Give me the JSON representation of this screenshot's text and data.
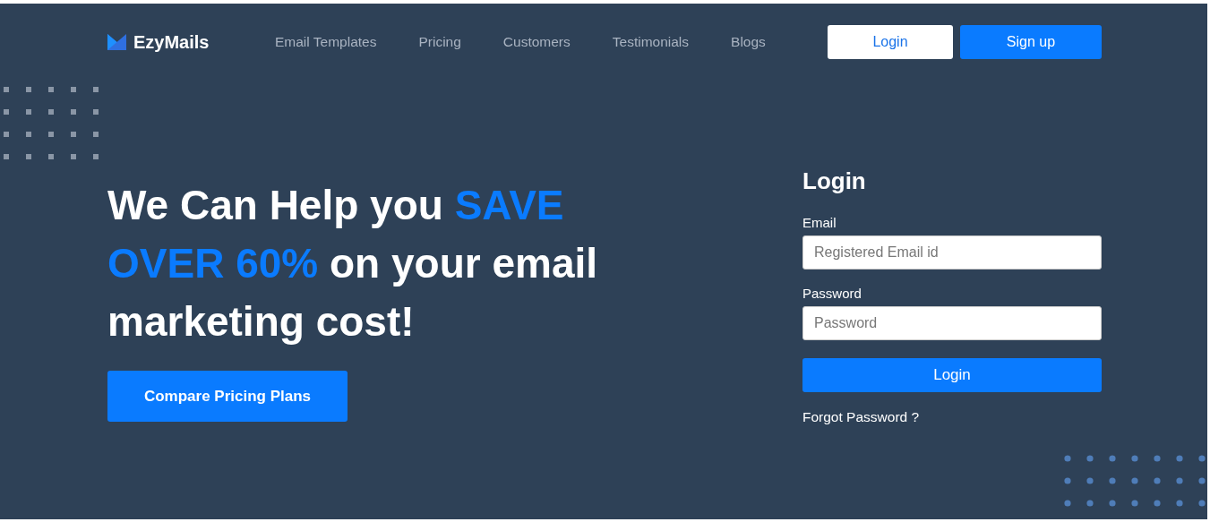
{
  "brand": {
    "name": "EzyMails"
  },
  "nav": {
    "links": [
      "Email Templates",
      "Pricing",
      "Customers",
      "Testimonials",
      "Blogs"
    ],
    "login": "Login",
    "signup": "Sign up"
  },
  "hero": {
    "headline": [
      {
        "text": "We Can Help you ",
        "highlight": false
      },
      {
        "text": "SAVE OVER 60%",
        "highlight": true
      },
      {
        "text": " on your email marketing cost!",
        "highlight": false
      }
    ],
    "cta": "Compare Pricing Plans"
  },
  "login_form": {
    "title": "Login",
    "fields": [
      {
        "label": "Email",
        "placeholder": "Registered Email id"
      },
      {
        "label": "Password",
        "placeholder": "Password"
      }
    ],
    "submit": "Login",
    "forgot": "Forgot Password ?"
  }
}
